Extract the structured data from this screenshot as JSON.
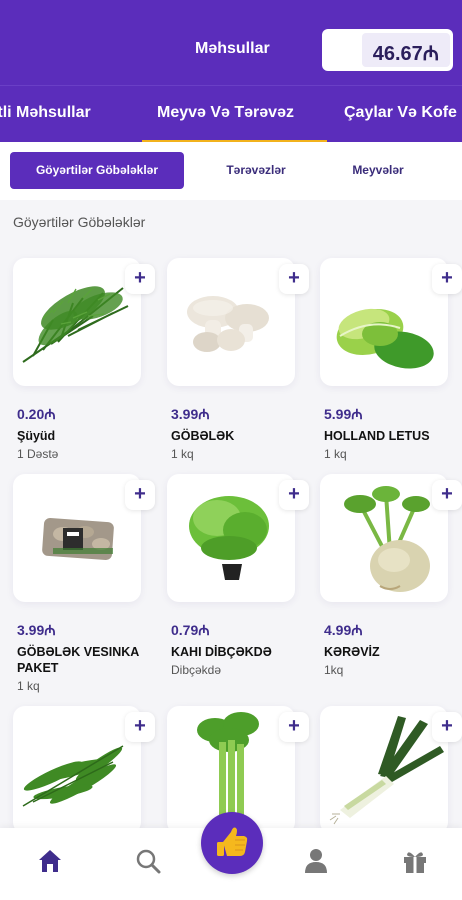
{
  "header": {
    "title": "Məhsullar",
    "cart_total": "46.67₼"
  },
  "categories": [
    {
      "label": "Paketli Məhsullar"
    },
    {
      "label": "Meyvə Və Tərəvəz"
    },
    {
      "label": "Çaylar Və Kofe"
    }
  ],
  "subcategories": [
    {
      "label": "Göyərtilər Göbələklər"
    },
    {
      "label": "Tərəvəzlər"
    },
    {
      "label": "Meyvələr"
    }
  ],
  "section_title": "Göyərtilər Göbələklər",
  "products": [
    {
      "price": "0.20₼",
      "name": "Şüyüd",
      "unit": "1 Dəstə",
      "image": "dill-image"
    },
    {
      "price": "3.99₼",
      "name": "GÖBƏLƏK",
      "unit": "1 kq",
      "image": "mushroom-image"
    },
    {
      "price": "5.99₼",
      "name": "HOLLAND LETUS",
      "unit": "1 kq",
      "image": "lettuce-image"
    },
    {
      "price": "3.99₼",
      "name": "GÖBƏLƏK VESINKA PAKET",
      "unit": "1 kq",
      "image": "mushroom-pack-image"
    },
    {
      "price": "0.79₼",
      "name": "KAHI DİBÇƏKDƏ",
      "unit": "Dibçəkdə",
      "image": "potted-lettuce-image"
    },
    {
      "price": "4.99₼",
      "name": "KƏRƏVİZ",
      "unit": "1kq",
      "image": "celeriac-image"
    },
    {
      "image": "tarragon-image"
    },
    {
      "image": "celery-image"
    },
    {
      "image": "leek-image"
    }
  ],
  "add_label": "+",
  "nav": {
    "items": [
      "home-icon",
      "search-icon",
      "thumbs-up-icon",
      "profile-icon",
      "gift-icon"
    ]
  },
  "colors": {
    "brand": "#5b2dbb",
    "accent": "#f2b21c",
    "price": "#3f2d8c"
  }
}
